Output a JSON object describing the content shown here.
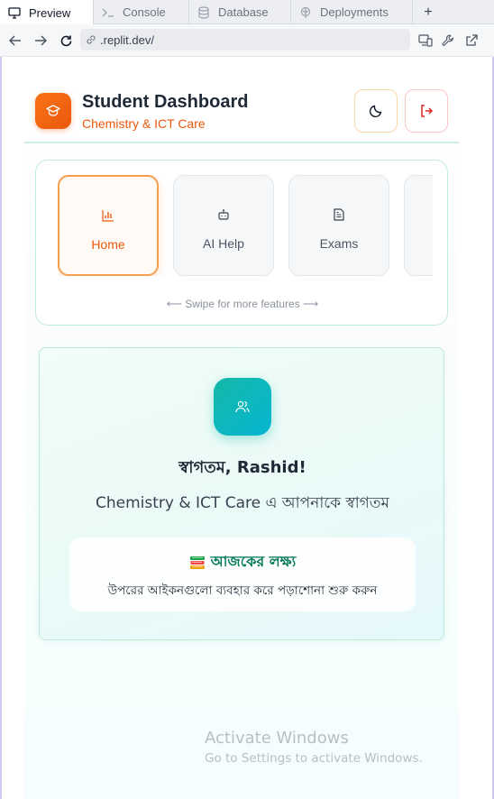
{
  "tabs": [
    {
      "label": "Preview",
      "icon": "monitor-icon",
      "active": true
    },
    {
      "label": "Console",
      "icon": "terminal-icon",
      "active": false
    },
    {
      "label": "Database",
      "icon": "database-icon",
      "active": false
    },
    {
      "label": "Deployments",
      "icon": "deploy-icon",
      "active": false
    }
  ],
  "tab_add": "+",
  "address": {
    "url": ".replit.dev/"
  },
  "app": {
    "title": "Student Dashboard",
    "subtitle": "Chemistry & ICT Care",
    "accent": "#ea580c",
    "teal": "#14b8a6"
  },
  "features": {
    "items": [
      {
        "label": "Home",
        "icon": "bar-chart-icon",
        "active": true
      },
      {
        "label": "AI Help",
        "icon": "robot-icon",
        "active": false
      },
      {
        "label": "Exams",
        "icon": "document-icon",
        "active": false
      }
    ],
    "swipe_hint": "⟵ Swipe for more features ⟶"
  },
  "welcome": {
    "greeting": "স্বাগতম, Rashid!",
    "subtitle": "Chemistry & ICT Care এ আপনাকে স্বাগতম",
    "goal_title": "আজকের লক্ষ্য",
    "goal_text": "উপরের আইকনগুলো ব্যবহার করে পড়াশোনা শুরু করুন"
  },
  "watermark": {
    "line1": "Activate Windows",
    "line2": "Go to Settings to activate Windows."
  }
}
